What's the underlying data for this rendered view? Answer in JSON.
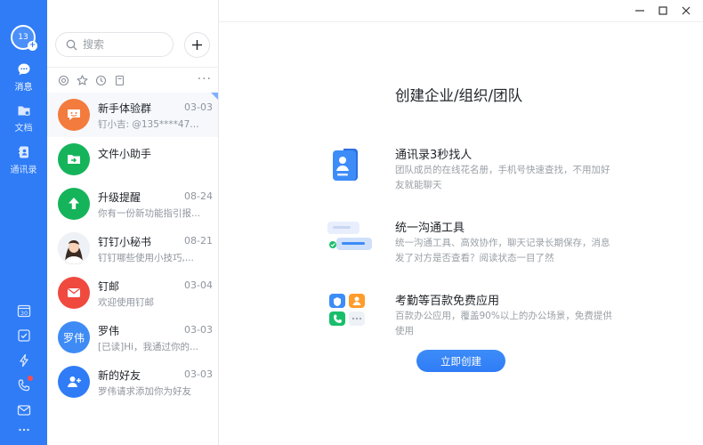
{
  "user": {
    "avatar_text": "13"
  },
  "rail": {
    "items": [
      {
        "label": "消息",
        "icon": "chat-bubble-icon"
      },
      {
        "label": "文档",
        "icon": "folder-icon"
      },
      {
        "label": "通讯录",
        "icon": "contacts-book-icon"
      }
    ],
    "bottom_icons": [
      "calendar-30-icon",
      "checkbox-todo-icon",
      "lightning-icon",
      "phone-icon",
      "mail-icon",
      "more-dots-icon"
    ],
    "calendar_day": "30",
    "accent": "#2f7cf6"
  },
  "search": {
    "placeholder": "搜索"
  },
  "filter_bar": {
    "icons": [
      "at-icon",
      "star-icon",
      "clock-icon",
      "document-icon"
    ],
    "more": "···"
  },
  "conversations": [
    {
      "name": "新手体验群",
      "time": "03-03",
      "preview": "钉小吉: @135****4757...",
      "avatar_color": "#f37b3d"
    },
    {
      "name": "文件小助手",
      "time": "",
      "preview": "",
      "avatar_color": "#15b45a"
    },
    {
      "name": "升级提醒",
      "time": "08-24",
      "preview": "你有一份新功能指引报...",
      "avatar_color": "#15b45a"
    },
    {
      "name": "钉钉小秘书",
      "time": "08-21",
      "preview": "钉钉哪些使用小技巧,...",
      "avatar_color": "#f0c8a8"
    },
    {
      "name": "钉邮",
      "time": "03-04",
      "preview": "欢迎使用钉邮",
      "avatar_color": "#f0493e"
    },
    {
      "name": "罗伟",
      "time": "03-03",
      "preview": "[已读]Hi，我通过你的...",
      "avatar_color": "#3e8bf5",
      "avatar_text": "罗伟"
    },
    {
      "name": "新的好友",
      "time": "03-03",
      "preview": "罗伟请求添加你为好友",
      "avatar_color": "#2f7cf6"
    }
  ],
  "main": {
    "title": "创建企业/组织/团队",
    "features": [
      {
        "title": "通讯录3秒找人",
        "desc": "团队成员的在线花名册，手机号快速查找，不用加好友就能聊天"
      },
      {
        "title": "统一沟通工具",
        "desc": "统一沟通工具、高效协作，聊天记录长期保存，消息发了对方是否查看？阅读状态一目了然"
      },
      {
        "title": "考勤等百款免费应用",
        "desc": "百款办公应用，覆盖90%以上的办公场景，免费提供使用"
      }
    ],
    "create_button": "立即创建"
  }
}
